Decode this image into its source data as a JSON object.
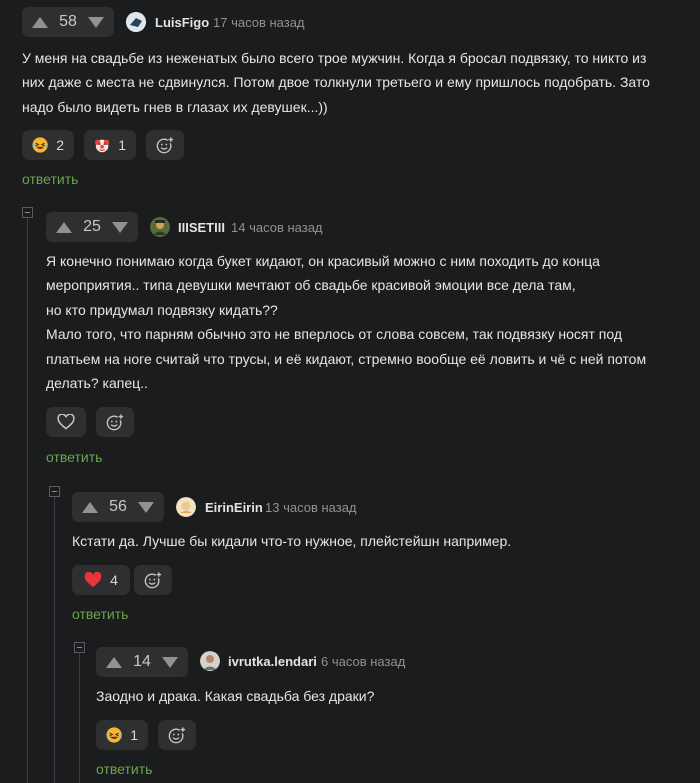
{
  "comments": [
    {
      "votes": "58",
      "author": "LuisFigo",
      "time": "17 часов назад",
      "text": "У меня на свадьбе из неженатых было всего трое мужчин. Когда я бросал подвязку, то никто из\nних даже с места не сдвинулся. Потом двое толкнули третьего и ему пришлось подобрать. Зато\nнадо было видеть гнев в глазах их девушек...))",
      "reactions": [
        {
          "icon": "laughing-emoji-icon",
          "count": "2"
        },
        {
          "icon": "clown-emoji-icon",
          "count": "1"
        }
      ],
      "reply": "ответить"
    },
    {
      "votes": "25",
      "author": "IIISETIII",
      "time": "14 часов назад",
      "text": "Я конечно понимаю когда букет кидают, он красивый можно с ним походить до конца\nмероприятия.. типа девушки мечтают об свадьбе красивой эмоции все дела там,\nно кто придумал подвязку кидать??\nМало того, что парням обычно это не вперлось от слова совсем, так подвязку носят под\nплатьем на ноге считай что трусы, и её кидают, стремно вообще её ловить и чё с ней потом\nделать? капец..",
      "reactions": [],
      "reply": "ответить"
    },
    {
      "votes": "56",
      "author": "EirinEirin",
      "time": "13 часов назад",
      "text": "Кстати да. Лучше бы кидали что-то нужное, плейстейшн например.",
      "reactions": [
        {
          "icon": "heart-red-icon",
          "count": "4"
        }
      ],
      "reply": "ответить"
    },
    {
      "votes": "14",
      "author": "ivrutka.lendari",
      "time": "6 часов назад",
      "text": "Заодно и драка. Какая свадьба без драки?",
      "reactions": [
        {
          "icon": "laughing-emoji-icon",
          "count": "1"
        }
      ],
      "reply": "ответить"
    }
  ],
  "colors": {
    "background": "#1b1c1e",
    "panel": "#2d2f31",
    "reply_link": "#6aa64a",
    "heart": "#e8343b"
  }
}
